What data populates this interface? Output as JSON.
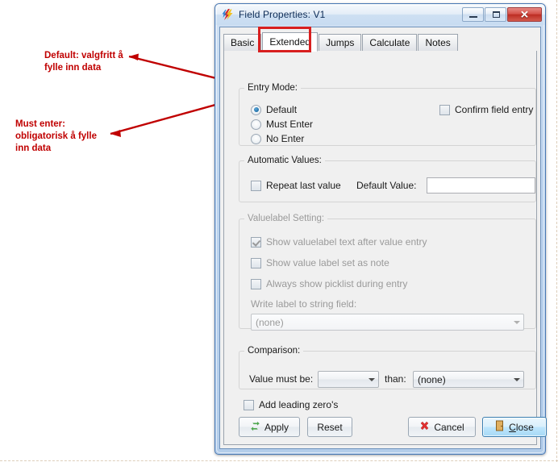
{
  "annotations": [
    {
      "id": "ann-default",
      "text": "Default: valgfritt å\nfylle inn data",
      "color": "#c00000"
    },
    {
      "id": "ann-must",
      "text": "Must enter:\nobligatorisk å fylle\ninn data",
      "color": "#c00000"
    }
  ],
  "highlight_color": "#d81f1f",
  "window": {
    "title": "Field Properties: V1",
    "icon": "app-lightning-icon",
    "controls": {
      "minimize": "minimize-button",
      "maximize": "maximize-button",
      "close": "close-button",
      "close_glyph": "✕"
    }
  },
  "tabs": [
    {
      "label": "Basic",
      "active": false
    },
    {
      "label": "Extended",
      "active": true
    },
    {
      "label": "Jumps",
      "active": false
    },
    {
      "label": "Calculate",
      "active": false
    },
    {
      "label": "Notes",
      "active": false
    }
  ],
  "entry_mode": {
    "legend": "Entry Mode:",
    "options": [
      {
        "label": "Default",
        "checked": true
      },
      {
        "label": "Must Enter",
        "checked": false
      },
      {
        "label": "No Enter",
        "checked": false
      }
    ],
    "confirm_field_entry": {
      "label": "Confirm field entry",
      "checked": false
    }
  },
  "automatic_values": {
    "legend": "Automatic Values:",
    "repeat_last_value": {
      "label": "Repeat last value",
      "checked": false
    },
    "default_value": {
      "label": "Default Value:",
      "value": "",
      "placeholder": ""
    }
  },
  "valuelabel_setting": {
    "legend": "Valuelabel Setting:",
    "disabled": true,
    "checkboxes": [
      {
        "label": "Show valuelabel text after value entry",
        "checked": true
      },
      {
        "label": "Show value label set as note",
        "checked": false
      },
      {
        "label": "Always show picklist during entry",
        "checked": false
      }
    ],
    "write_label": {
      "label": "Write label to string field:",
      "selected": "(none)"
    }
  },
  "comparison": {
    "legend": "Comparison:",
    "value_must_be_label": "Value must be:",
    "operator_selected": "",
    "than_label": "than:",
    "target_selected": "(none)"
  },
  "add_leading_zeros": {
    "label": "Add leading zero's",
    "checked": false
  },
  "buttons": {
    "apply": {
      "label": "Apply",
      "icon": "refresh-arrows-icon"
    },
    "reset": {
      "label": "Reset"
    },
    "cancel": {
      "label": "Cancel",
      "icon": "red-x-icon"
    },
    "close": {
      "label": "Close",
      "accel": "C",
      "icon": "door-icon",
      "default": true
    }
  }
}
